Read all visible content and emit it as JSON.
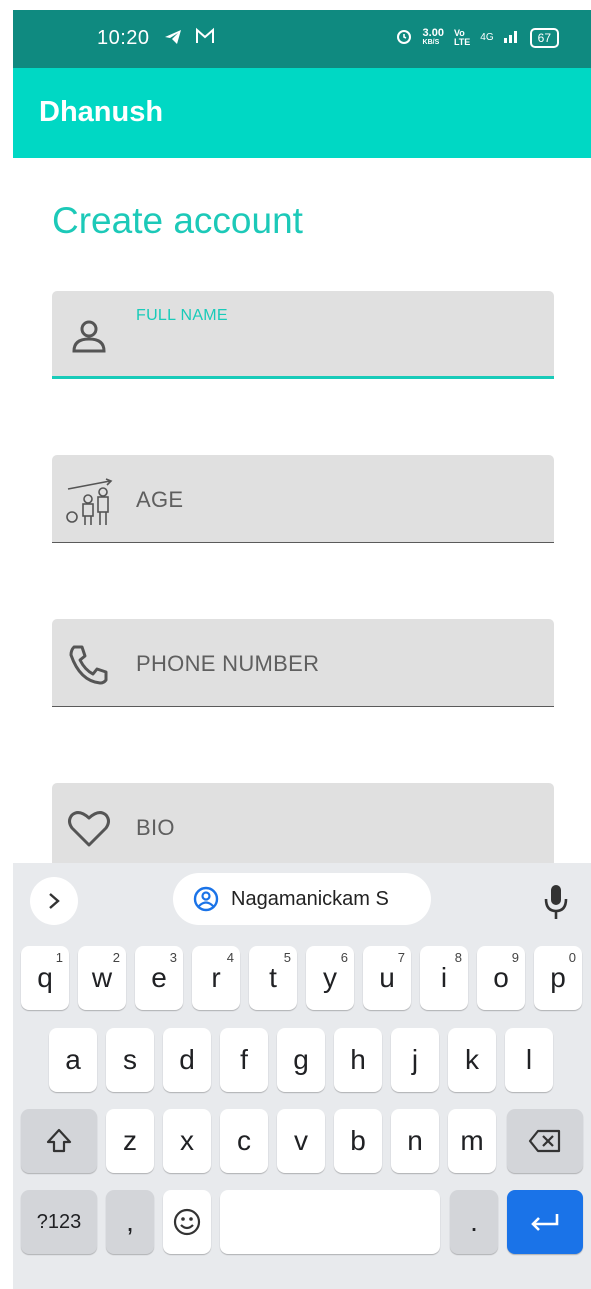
{
  "status_bar": {
    "time": "10:20",
    "speed": "3.00",
    "speed_unit": "KB/S",
    "volte": "Vo",
    "lte": "LTE",
    "network": "4G",
    "battery": "67"
  },
  "app_bar": {
    "title": "Dhanush"
  },
  "form": {
    "title": "Create account",
    "fields": [
      {
        "label": "FULL NAME",
        "icon": "person-icon",
        "active": true
      },
      {
        "label": "AGE",
        "icon": "age-icon",
        "active": false
      },
      {
        "label": "PHONE NUMBER",
        "icon": "phone-icon",
        "active": false
      },
      {
        "label": "BIO",
        "icon": "heart-icon",
        "active": false
      }
    ]
  },
  "keyboard": {
    "suggestion": "Nagamanickam S",
    "row1": [
      "q",
      "w",
      "e",
      "r",
      "t",
      "y",
      "u",
      "i",
      "o",
      "p"
    ],
    "row1_hints": [
      "1",
      "2",
      "3",
      "4",
      "5",
      "6",
      "7",
      "8",
      "9",
      "0"
    ],
    "row2": [
      "a",
      "s",
      "d",
      "f",
      "g",
      "h",
      "j",
      "k",
      "l"
    ],
    "row3": [
      "z",
      "x",
      "c",
      "v",
      "b",
      "n",
      "m"
    ],
    "symbols_label": "?123",
    "comma": ",",
    "period": ".",
    "colors": {
      "enter": "#1a73e8",
      "accent": "#19cbb9"
    }
  }
}
